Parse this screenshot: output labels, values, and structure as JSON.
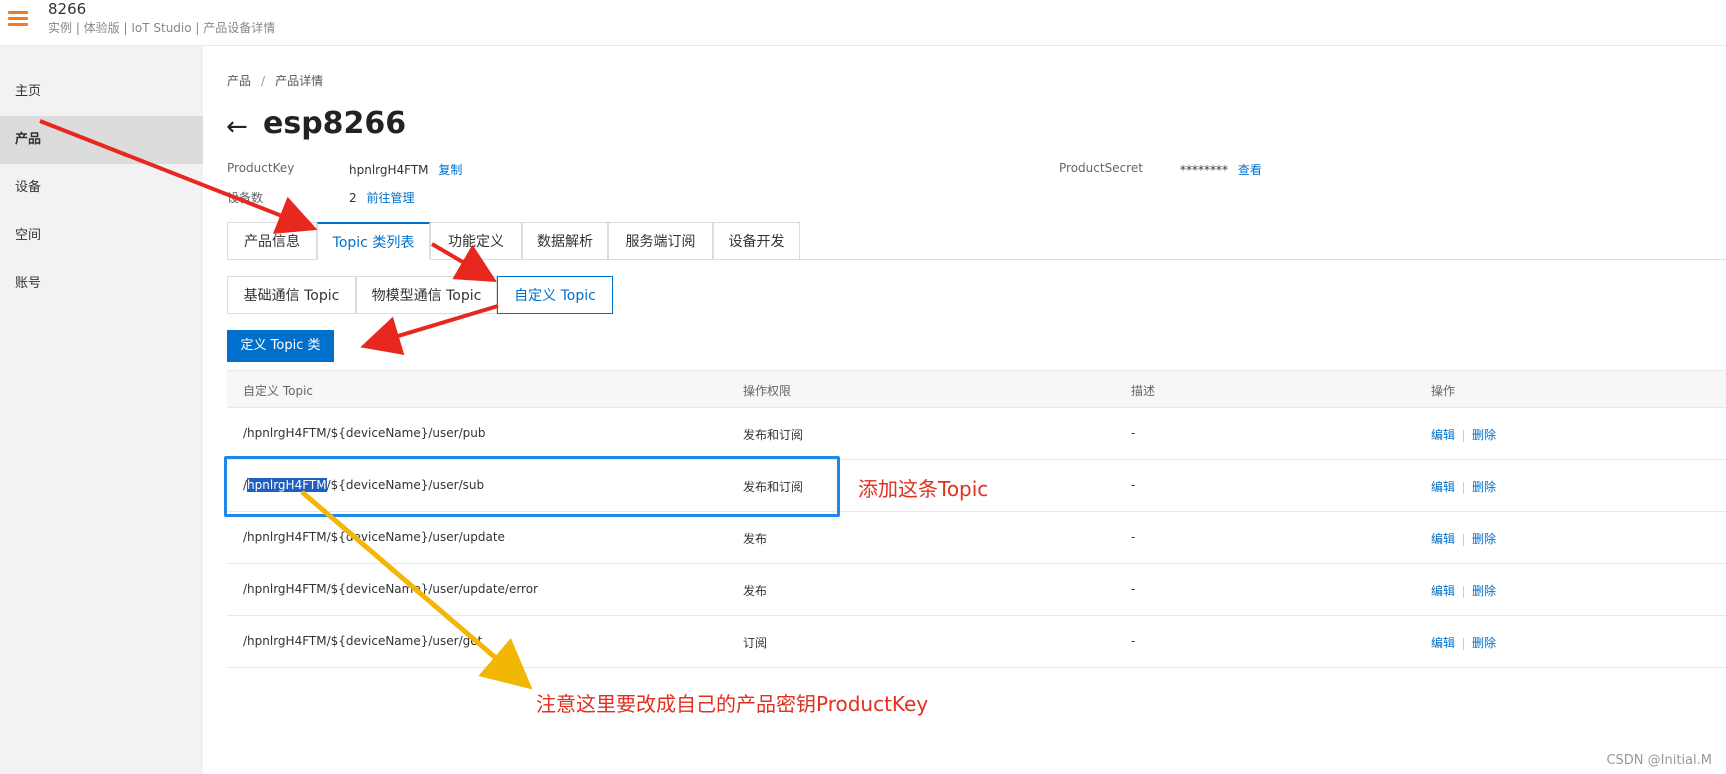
{
  "header": {
    "app_title": "8266",
    "app_subtitle": "实例 | 体验版 | IoT Studio | 产品设备详情"
  },
  "sidebar": {
    "items": [
      {
        "label": "主页"
      },
      {
        "label": "产品",
        "active": true
      },
      {
        "label": "设备"
      },
      {
        "label": "空间"
      },
      {
        "label": "账号"
      }
    ]
  },
  "breadcrumb": {
    "items": [
      "产品",
      "产品详情"
    ],
    "separator": "/"
  },
  "page": {
    "back_symbol": "←",
    "title": "esp8266"
  },
  "info": {
    "product_key_label": "ProductKey",
    "product_key_value": "hpnlrgH4FTM",
    "copy_link": "复制",
    "product_secret_label": "ProductSecret",
    "product_secret_value": "********",
    "view_link": "查看",
    "device_count_label": "设备数",
    "device_count_value": "2",
    "manage_link": "前往管理"
  },
  "tabs": [
    {
      "label": "产品信息"
    },
    {
      "label": "Topic 类列表",
      "active": true
    },
    {
      "label": "功能定义"
    },
    {
      "label": "数据解析"
    },
    {
      "label": "服务端订阅"
    },
    {
      "label": "设备开发"
    }
  ],
  "subtabs": [
    {
      "label": "基础通信 Topic"
    },
    {
      "label": "物模型通信 Topic"
    },
    {
      "label": "自定义 Topic",
      "active": true
    }
  ],
  "define_button": "定义 Topic 类",
  "table": {
    "headers": [
      "自定义 Topic",
      "操作权限",
      "描述",
      "操作"
    ],
    "rows": [
      {
        "topic_prefix": "/",
        "topic_key": "hpnlrgH4FTM",
        "topic_suffix": "/${deviceName}/user/pub",
        "permission": "发布和订阅",
        "desc": "-",
        "edit": "编辑",
        "delete": "删除"
      },
      {
        "topic_prefix": "/",
        "topic_key": "hpnlrgH4FTM",
        "topic_suffix": "/${deviceName}/user/sub",
        "permission": "发布和订阅",
        "desc": "-",
        "edit": "编辑",
        "delete": "删除"
      },
      {
        "topic_prefix": "/",
        "topic_key": "hpnlrgH4FTM",
        "topic_suffix": "/${deviceName}/user/update",
        "permission": "发布",
        "desc": "-",
        "edit": "编辑",
        "delete": "删除"
      },
      {
        "topic_prefix": "/",
        "topic_key": "hpnlrgH4FTM",
        "topic_suffix": "/${deviceName}/user/update/error",
        "permission": "发布",
        "desc": "-",
        "edit": "编辑",
        "delete": "删除"
      },
      {
        "topic_prefix": "/",
        "topic_key": "hpnlrgH4FTM",
        "topic_suffix": "/${deviceName}/user/get",
        "permission": "订阅",
        "desc": "-",
        "edit": "编辑",
        "delete": "删除"
      }
    ]
  },
  "annotations": {
    "add_topic": "添加这条Topic",
    "note_product_key": "注意这里要改成自己的产品密钥ProductKey",
    "arrow_red": "#e8281e",
    "arrow_yellow": "#f2b705",
    "box_blue": "#1e88e5"
  },
  "watermark": "CSDN @Initial.M"
}
